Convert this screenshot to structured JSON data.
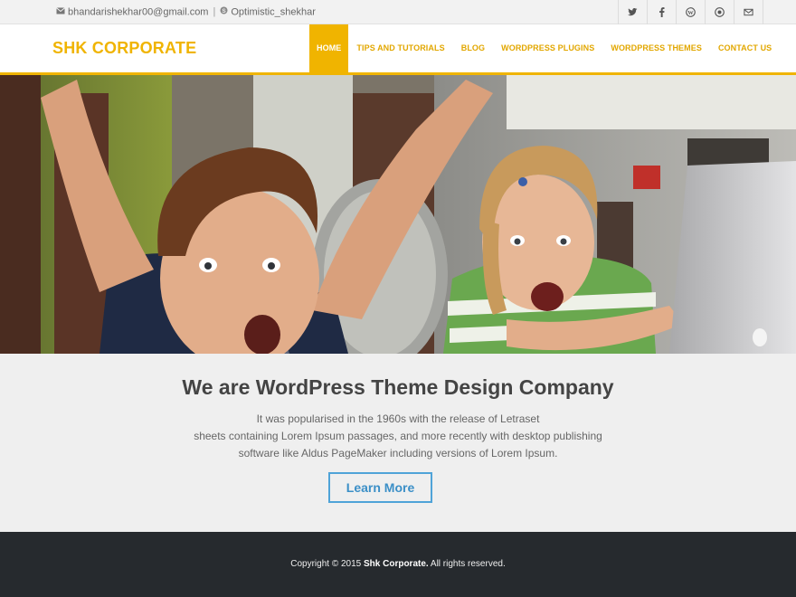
{
  "topbar": {
    "email": "bhandarishekhar00@gmail.com",
    "separator": "|",
    "skype": "Optimistic_shekhar",
    "social_icons": [
      "twitter-icon",
      "facebook-icon",
      "wordpress-icon",
      "dribbble-icon",
      "mail-icon"
    ]
  },
  "header": {
    "logo": "SHK CORPORATE",
    "nav": [
      "HOME",
      "TIPS AND TUTORIALS",
      "BLOG",
      "WORDPRESS PLUGINS",
      "WORDPRESS THEMES",
      "CONTACT US"
    ],
    "active_nav": "HOME"
  },
  "intro": {
    "heading": "We are WordPress Theme Design Company",
    "lines": [
      "It was popularised in the 1960s with the release of Letraset",
      "sheets containing Lorem Ipsum passages, and more recently with desktop publishing",
      "software like Aldus PageMaker including versions of Lorem Ipsum."
    ],
    "button": "Learn More"
  },
  "footer": {
    "prefix": "Copyright © 2015 ",
    "company": "Shk Corporate.",
    "suffix": " All rights reserved."
  },
  "colors": {
    "accent": "#f0b400",
    "button_border": "#4fa3d8",
    "footer_bg": "#262a2e"
  }
}
